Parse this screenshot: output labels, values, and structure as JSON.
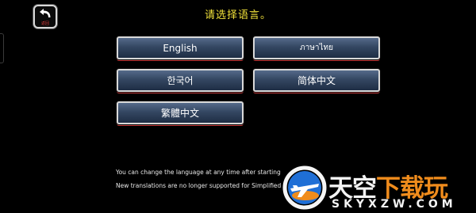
{
  "header": {
    "back_label": "返回",
    "title": "请选择语言。"
  },
  "languages": [
    {
      "label": "English"
    },
    {
      "label": "ภาษาไทย"
    },
    {
      "label": "한국어"
    },
    {
      "label": "简体中文"
    },
    {
      "label": "繁體中文"
    }
  ],
  "notes": {
    "line1": "You can change the language at any time after starting",
    "line2": "New translations are no longer supported for Simplified"
  },
  "watermark": {
    "title_main": "天空",
    "title_accent": "下载玩",
    "domain": "SKYXZW.COM"
  },
  "colors": {
    "title": "#f2e23a",
    "button_fill": "#344762",
    "button_border": "#d9d9d9",
    "button_underline": "#c63a3a",
    "watermark_accent": "#f08c1c"
  }
}
